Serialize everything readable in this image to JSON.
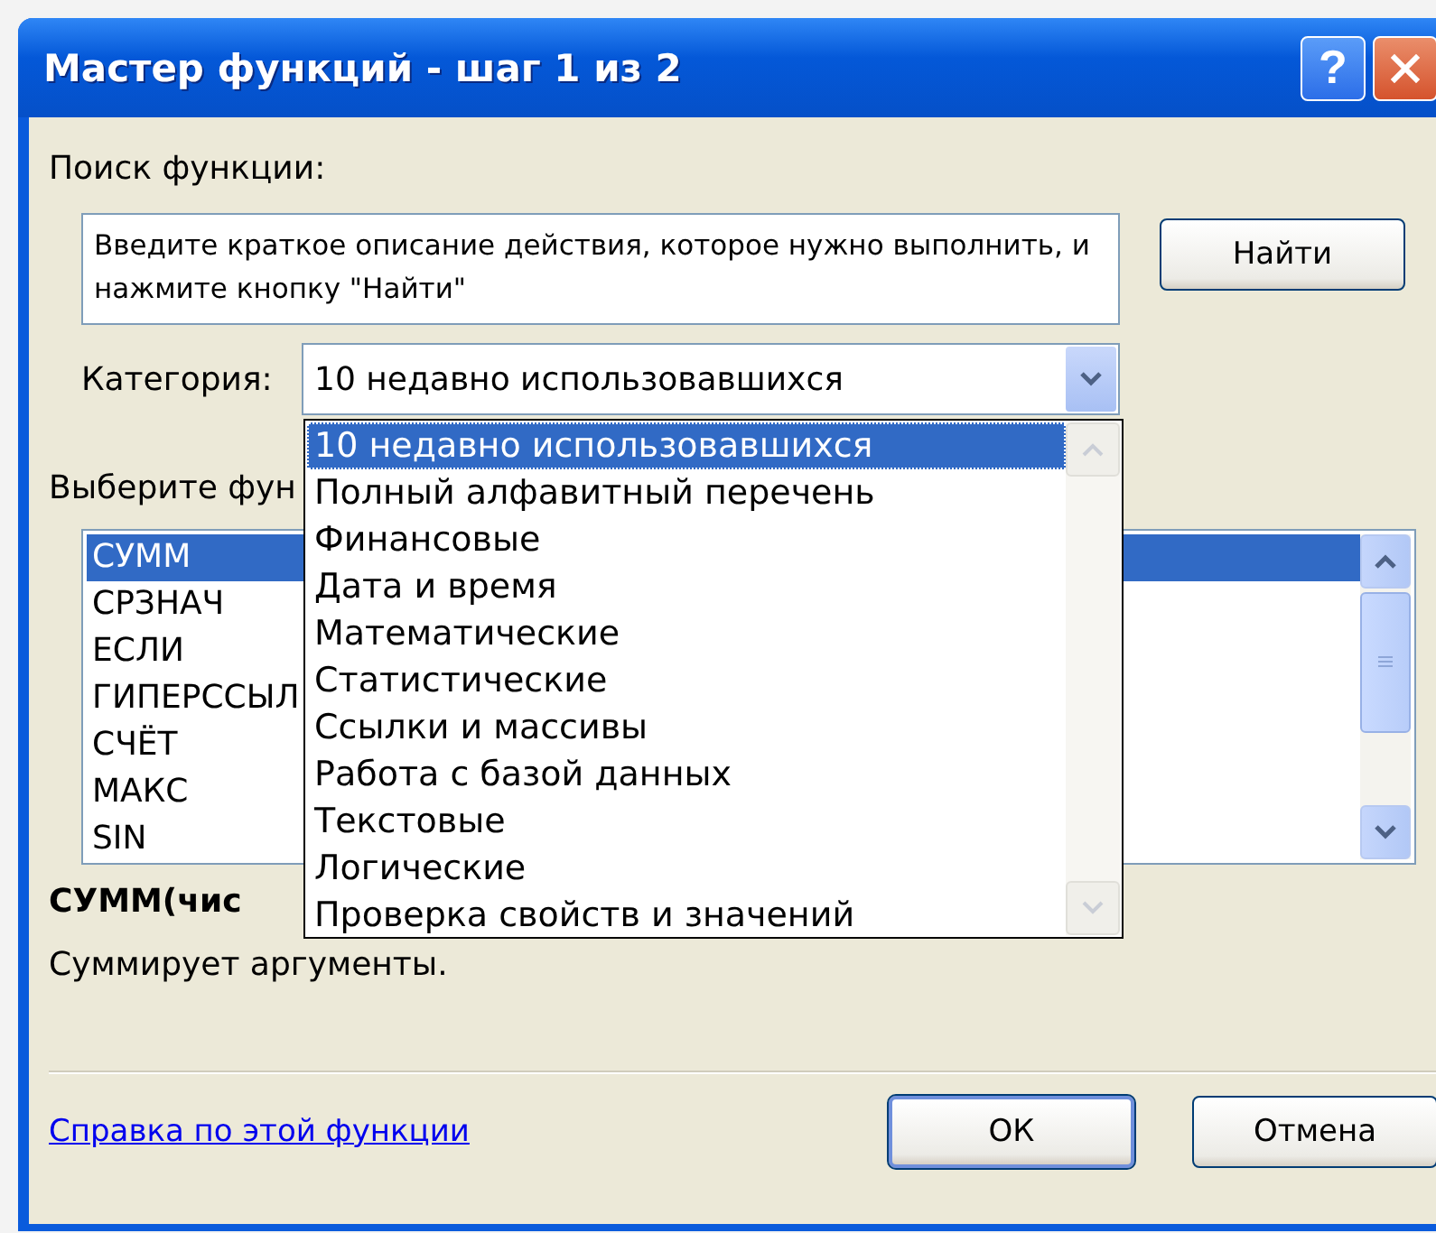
{
  "window": {
    "title": "Мастер функций - шаг 1 из 2",
    "help_label": "?"
  },
  "search": {
    "label": "Поиск функции:",
    "value": "Введите краткое описание действия, которое нужно выполнить, и нажмите кнопку \"Найти\"",
    "button": "Найти"
  },
  "category": {
    "label": "Категория:",
    "value": "10 недавно использовавшихся",
    "open": true,
    "options": [
      {
        "label": "10 недавно использовавшихся",
        "selected": true
      },
      {
        "label": "Полный алфавитный перечень",
        "selected": false
      },
      {
        "label": "Финансовые",
        "selected": false
      },
      {
        "label": "Дата и время",
        "selected": false
      },
      {
        "label": "Математические",
        "selected": false
      },
      {
        "label": "Статистические",
        "selected": false
      },
      {
        "label": "Ссылки и массивы",
        "selected": false
      },
      {
        "label": "Работа с базой данных",
        "selected": false
      },
      {
        "label": "Текстовые",
        "selected": false
      },
      {
        "label": "Логические",
        "selected": false
      },
      {
        "label": "Проверка свойств и значений",
        "selected": false
      }
    ]
  },
  "function_list": {
    "label": "Выберите фун",
    "items": [
      {
        "label": "СУММ",
        "selected": true
      },
      {
        "label": "СРЗНАЧ",
        "selected": false
      },
      {
        "label": "ЕСЛИ",
        "selected": false
      },
      {
        "label": "ГИПЕРССЫЛ",
        "selected": false
      },
      {
        "label": "СЧЁТ",
        "selected": false
      },
      {
        "label": "МАКС",
        "selected": false
      },
      {
        "label": "SIN",
        "selected": false
      }
    ]
  },
  "signature": "СУММ(чис",
  "description": "Суммирует аргументы.",
  "help_link": "Справка по этой функции",
  "buttons": [
    {
      "label": "ОК",
      "default": true
    },
    {
      "label": "Отмена",
      "default": false
    }
  ]
}
